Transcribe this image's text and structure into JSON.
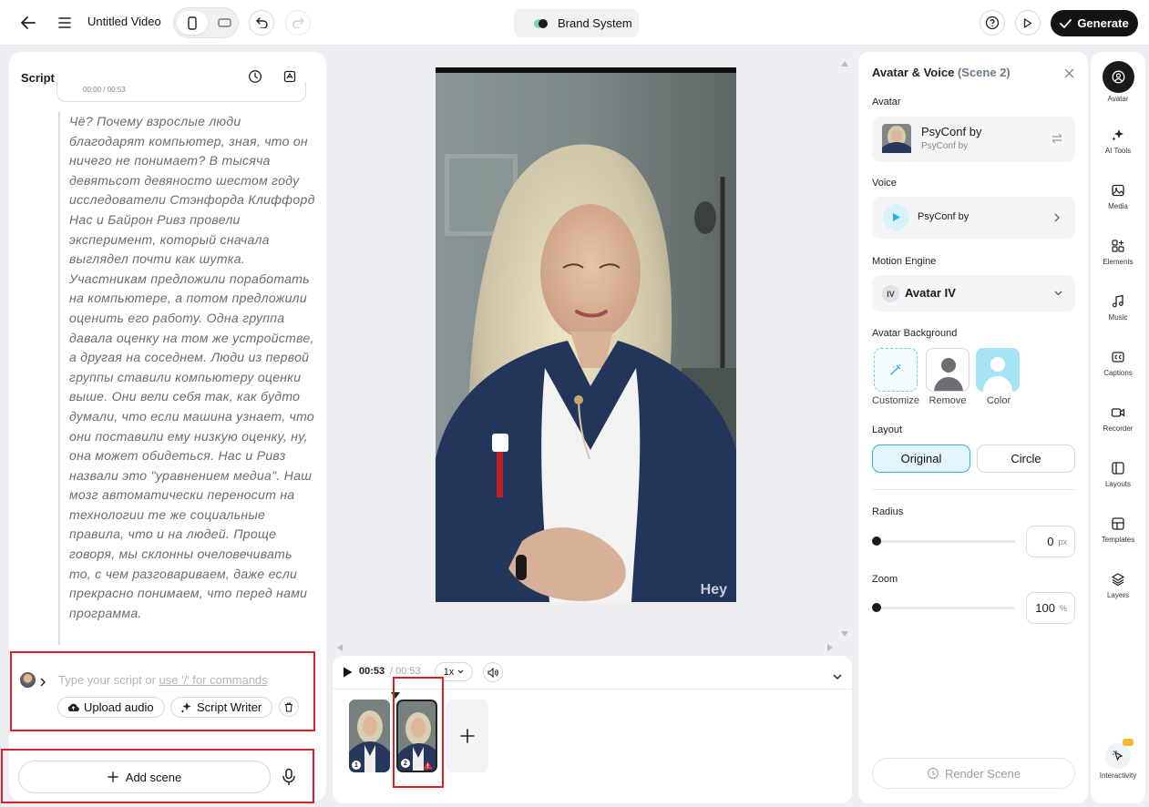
{
  "header": {
    "title": "Untitled Video",
    "brand_label": "Brand System",
    "generate_label": "Generate"
  },
  "script_panel": {
    "title": "Script",
    "timestamp": "00:00 / 00:53",
    "text": "Чё? Почему взрослые люди благодарят компьютер, зная, что он ничего не понимает? В тысяча девятьсот девяносто шестом году исследователи Стэнфорда Клиффорд Нас и Байрон Ривз провели эксперимент, который сначала выглядел почти как шутка. Участникам предложили поработать на компьютере, а потом предложили оценить его работу. Одна группа давала оценку на том же устройстве, а другая на соседнем. Люди из первой группы ставили компьютеру оценки выше. Они вели себя так, как будто думали, что если машина узнает, что они поставили ему низкую оценку, ну, она может обидеться. Нас и Ривз назвали это \"уравнением медиа\". Наш мозг автоматически переносит на технологии те же социальные правила, что и на людей. Проще говоря, мы склонны очеловечивать то, с чем разговариваем, даже если прекрасно понимаем, что перед нами программа.",
    "input_placeholder_prefix": "Type your script or ",
    "input_placeholder_link": "use '/' for commands",
    "upload_audio_label": "Upload audio",
    "script_writer_label": "Script Writer",
    "add_scene_label": "Add scene"
  },
  "canvas": {
    "watermark": "Hey"
  },
  "timeline": {
    "current_time": "00:53",
    "total_time": "/ 00:53",
    "speed": "1x",
    "scenes": [
      {
        "number": "1",
        "warning": false
      },
      {
        "number": "2",
        "warning": true
      }
    ]
  },
  "avatar_panel": {
    "title": "Avatar & Voice",
    "scene_label": "(Scene 2)",
    "avatar_section": "Avatar",
    "avatar_name": "PsyConf by",
    "avatar_sub": "PsyConf by",
    "voice_section": "Voice",
    "voice_name": "PsyConf by",
    "motion_section": "Motion Engine",
    "motion_badge": "IV",
    "motion_value": "Avatar IV",
    "background_section": "Avatar Background",
    "bg_options": [
      "Customize",
      "Remove",
      "Color"
    ],
    "layout_section": "Layout",
    "layout_options": [
      "Original",
      "Circle"
    ],
    "layout_selected": "Original",
    "radius_label": "Radius",
    "radius_value": "0",
    "radius_unit": "px",
    "radius_level": 0,
    "zoom_label": "Zoom",
    "zoom_value": "100",
    "zoom_unit": "%",
    "zoom_level": 0,
    "render_label": "Render Scene"
  },
  "sidebar": {
    "items": [
      "Avatar",
      "AI Tools",
      "Media",
      "Elements",
      "Music",
      "Captions",
      "Recorder",
      "Layouts",
      "Templates",
      "Layers"
    ],
    "interactivity_label": "Interactivity"
  },
  "colors": {
    "accent": "#2bb3d9",
    "selected_bg": "#e1f5fb",
    "highlight_box": "#d9202b",
    "generate_bg": "#141414"
  }
}
